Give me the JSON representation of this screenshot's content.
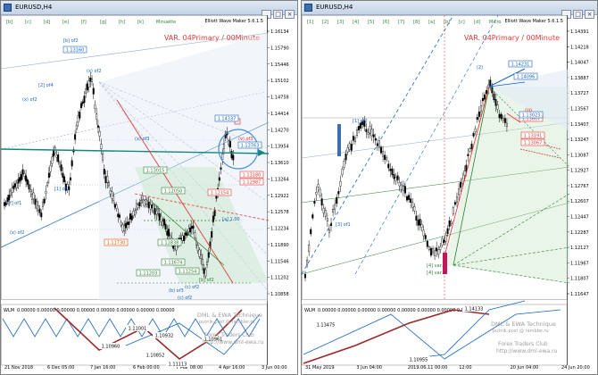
{
  "left": {
    "title": "EURUSD,H4",
    "header_right": "Elliott Wave Maker 5.6.1.5",
    "var_label": "VAR. 04Primary / 00Minute",
    "top_labels": [
      "[b]",
      "[c]",
      "[d]",
      "[e]",
      "[f]",
      "[g]",
      "[h]",
      "[k]",
      "Minuette"
    ],
    "price_axis": [
      "1.16134",
      "1.15790",
      "1.15446",
      "1.15102",
      "1.14758",
      "1.14414",
      "1.14270",
      "1.13954",
      "1.13610",
      "1.13264",
      "1.12922",
      "1.12578",
      "1.12234",
      "1.11890",
      "1.11546",
      "1.11202",
      "1.10858"
    ],
    "date_axis": [
      "21 Nov 2018",
      "6 Dec 05:00",
      "7 Jan 16:00",
      "6 Feb 00:00",
      "7 Mar 08:00",
      "4 Apr 16:00",
      "3 Jun 00:00"
    ],
    "boxes": [
      {
        "text": "1.13015",
        "color": "#2e7d32"
      },
      {
        "text": "1.13160",
        "color": "#1565c0"
      },
      {
        "text": "1.14337",
        "color": "#1565c0"
      },
      {
        "text": "1.13763",
        "color": "#1565c0"
      },
      {
        "text": "1.13180",
        "color": "#e53935"
      },
      {
        "text": "1.12987",
        "color": "#e53935"
      },
      {
        "text": "1.11730",
        "color": "#e65100"
      },
      {
        "text": "1.11838",
        "color": "#2e7d32"
      },
      {
        "text": "1.11674",
        "color": "#2e7d32"
      },
      {
        "text": "1.11203",
        "color": "#2e7d32"
      },
      {
        "text": "1.11254",
        "color": "#2e7d32"
      },
      {
        "text": "1.12154",
        "color": "#e53935"
      },
      {
        "text": "1.12050",
        "color": "#2e7d32"
      }
    ],
    "wave_labels": [
      "[b] of2",
      "[2] of4",
      "(x) of2",
      "(x) of2",
      "[1] of1",
      "(x) of3",
      "[f] of1",
      "(b) of3",
      "(c) of2",
      "[b] of2",
      "[a] 1.00",
      "(v) of3",
      "(x) of2",
      "(c) of2"
    ],
    "indicator": {
      "name": "WLM",
      "values": "0.00000 0.00000 0.00000 0.00000 0.00000 0.00000 0.00000 0.00000",
      "watermark1": "DML & EWA Technique",
      "watermark2": "putnik-post @ rambler.ru",
      "watermark3": "Forex Traders Club",
      "watermark4": "http://www.dml-ewa.ru",
      "boxes": [
        "1.10852",
        "1.10960",
        "1.10932",
        "1.10961",
        "1.11001",
        "1.11113"
      ]
    }
  },
  "right": {
    "title": "EURUSD,H4",
    "header_right": "Elliott Wave Maker 5.6.1.5",
    "var_label": "VAR. 04Primary / 00Minute",
    "top_labels": [
      "[1]",
      "[2]",
      "[3]",
      "[4]",
      "[5]",
      "[6]",
      "[7]",
      "[8]",
      "[a]",
      "[b]",
      "[c]",
      "[d]",
      "Micro"
    ],
    "price_axis": [
      "1.14391",
      "1.14218",
      "1.14047",
      "1.13887",
      "1.13727",
      "1.13567",
      "1.13407",
      "1.13247",
      "1.13087",
      "1.12927",
      "1.12767",
      "1.12607",
      "1.12447",
      "1.12287",
      "1.12127",
      "1.11967",
      "1.11807",
      "1.11647"
    ],
    "date_axis": [
      "31 May 2019",
      "3 Jun 04:00",
      "2019.06.11 00:00",
      "12:00",
      "20 Jun 04:00",
      "24 Jun 20:00"
    ],
    "boxes": [
      {
        "text": "1.14231",
        "color": "#1565c0"
      },
      {
        "text": "1.14096",
        "color": "#1565c0"
      },
      {
        "text": "1.13607",
        "color": "#e53935"
      },
      {
        "text": "1.13191",
        "color": "#e53935"
      },
      {
        "text": "1.13067",
        "color": "#e53935"
      },
      {
        "text": "1.13023",
        "color": "#1565c0"
      }
    ],
    "wave_labels": [
      "[1] of2",
      "[3] of1",
      "(2)",
      "[4] var.",
      "[4] var.",
      "(iii)"
    ],
    "indicator": {
      "name": "WLM",
      "values": "0.00000 0.00000 0.00000 0.00000 0.00000 0.00000 0.00000 0.00000",
      "watermark1": "DML & EWA Technique",
      "watermark2": "putnik-post @ rambler.ru",
      "watermark3": "Forex Traders Club",
      "watermark4": "http://www.dml-ewa.ru",
      "boxes": [
        "1.13475",
        "1.14133",
        "1.10955"
      ]
    }
  },
  "colors": {
    "candle": "#000000",
    "teal": "#11887a",
    "blue": "#1565c0",
    "red": "#e53935",
    "green": "#43a047",
    "fib_blue": "#90a4c8"
  }
}
